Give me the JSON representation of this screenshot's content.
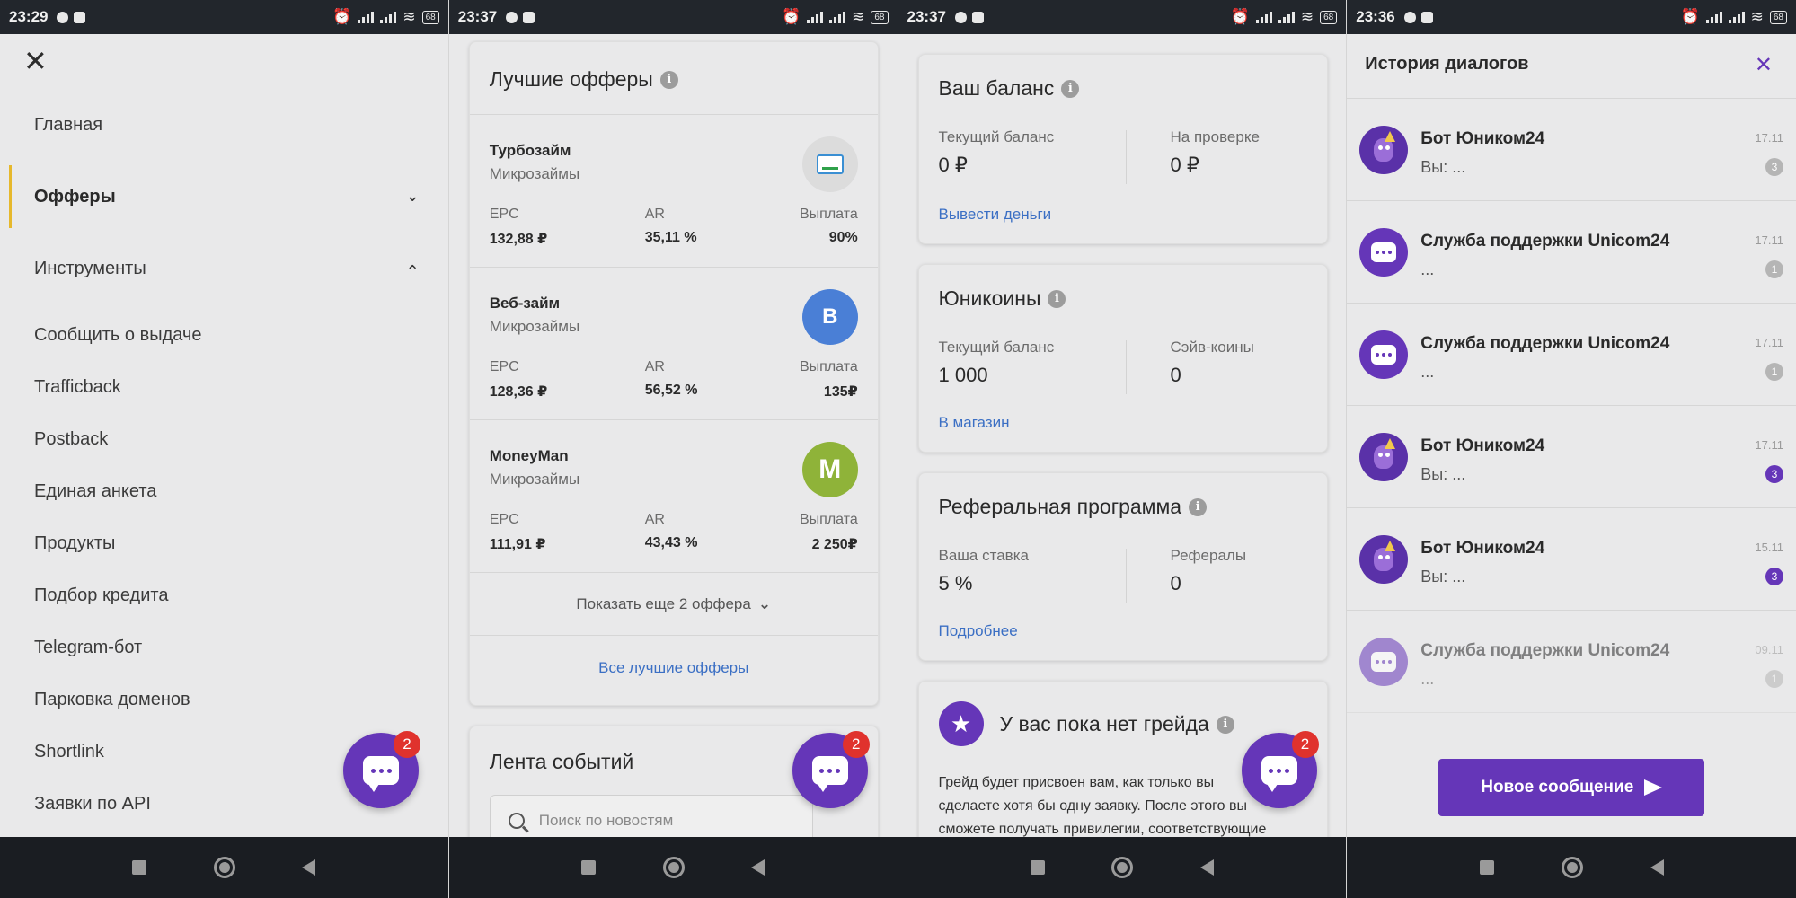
{
  "colors": {
    "accent": "#6536b8",
    "badge": "#e0322d",
    "link": "#3b6fc4",
    "active_marker": "#e6b82c"
  },
  "status_times": [
    "23:29",
    "23:37",
    "23:37",
    "23:36"
  ],
  "battery": "68",
  "fab_badge": "2",
  "menu": {
    "items": [
      {
        "label": "Главная"
      },
      {
        "label": "Офферы"
      },
      {
        "label": "Инструменты"
      },
      {
        "label": "Сообщить о выдаче"
      },
      {
        "label": "Trafficback"
      },
      {
        "label": "Postback"
      },
      {
        "label": "Единая анкета"
      },
      {
        "label": "Продукты"
      },
      {
        "label": "Подбор кредита"
      },
      {
        "label": "Telegram-бот"
      },
      {
        "label": "Парковка доменов"
      },
      {
        "label": "Shortlink"
      },
      {
        "label": "Заявки по API"
      }
    ]
  },
  "offers": {
    "title": "Лучшие офферы",
    "labels": {
      "epc": "EPC",
      "ar": "AR",
      "payout": "Выплата"
    },
    "items": [
      {
        "name": "Турбозайм",
        "category": "Микрозаймы",
        "epc": "132,88 ₽",
        "ar": "35,11 %",
        "payout": "90%",
        "logo": "",
        "logo_color": "#dcdcdc"
      },
      {
        "name": "Веб-займ",
        "category": "Микрозаймы",
        "epc": "128,36 ₽",
        "ar": "56,52 %",
        "payout": "135₽",
        "logo": "B",
        "logo_color": "#4a7fd6"
      },
      {
        "name": "MoneyMan",
        "category": "Микрозаймы",
        "epc": "111,91 ₽",
        "ar": "43,43 %",
        "payout": "2 250₽",
        "logo": "M",
        "logo_color": "#8fb339"
      }
    ],
    "show_more": "Показать еще 2 оффера",
    "all_link": "Все лучшие офферы"
  },
  "feed": {
    "title": "Лента событий",
    "search_placeholder": "Поиск по новостям"
  },
  "balance": {
    "title": "Ваш баланс",
    "current_label": "Текущий баланс",
    "current_value": "0 ₽",
    "review_label": "На проверке",
    "review_value": "0 ₽",
    "link": "Вывести деньги"
  },
  "coins": {
    "title": "Юникоины",
    "current_label": "Текущий баланс",
    "current_value": "1 000",
    "save_label": "Сэйв-коины",
    "save_value": "0",
    "link": "В магазин"
  },
  "referral": {
    "title": "Реферальная программа",
    "rate_label": "Ваша ставка",
    "rate_value": "5 %",
    "refs_label": "Рефералы",
    "refs_value": "0",
    "link": "Подробнее"
  },
  "grade": {
    "title": "У вас пока нет грейда",
    "text_lines": [
      "Грейд будет присвоен вам, как только вы",
      "сделаете хотя бы одну заявку. После этого вы",
      "сможете получать привилегии, соответствующие"
    ]
  },
  "history": {
    "title": "История диалогов",
    "dialogs": [
      {
        "name": "Бот Юником24",
        "msg": "Вы: ...",
        "date": "17.11",
        "count": "3",
        "bot": true,
        "unread": false
      },
      {
        "name": "Служба поддержки Unicom24",
        "msg": "...",
        "date": "17.11",
        "count": "1",
        "bot": false,
        "unread": false
      },
      {
        "name": "Служба поддержки Unicom24",
        "msg": "...",
        "date": "17.11",
        "count": "1",
        "bot": false,
        "unread": false
      },
      {
        "name": "Бот Юником24",
        "msg": "Вы: ...",
        "date": "17.11",
        "count": "3",
        "bot": true,
        "unread": true
      },
      {
        "name": "Бот Юником24",
        "msg": "Вы: ...",
        "date": "15.11",
        "count": "3",
        "bot": true,
        "unread": true
      },
      {
        "name": "Служба поддержки Unicom24",
        "msg": "...",
        "date": "09.11",
        "count": "1",
        "bot": false,
        "unread": false
      }
    ],
    "new_message": "Новое сообщение"
  }
}
